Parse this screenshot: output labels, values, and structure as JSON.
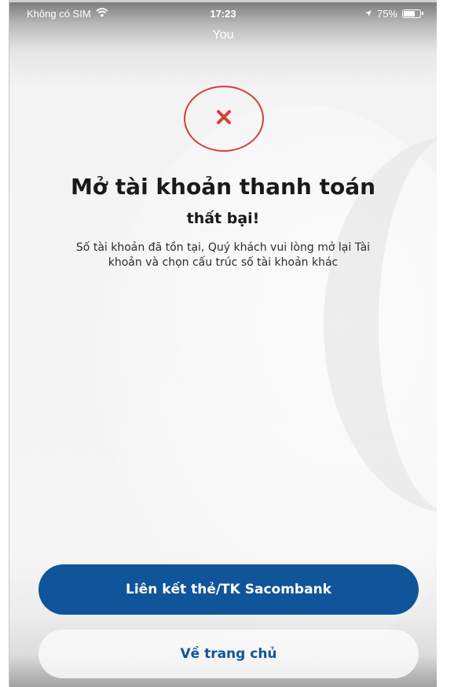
{
  "status_bar": {
    "carrier": "Không có SIM",
    "time": "17:23",
    "battery": "75%",
    "battery_level": 0.75,
    "icons": [
      "wifi-icon",
      "location-arrow-icon",
      "battery-icon"
    ]
  },
  "nav": {
    "title": "You"
  },
  "result": {
    "icon": "close-icon",
    "icon_color": "#d6403a",
    "title_line1": "Mở tài khoản thanh toán",
    "title_line2": "thất bại!",
    "message": "Số tài khoản đã tồn tại, Quý khách vui lòng mở lại Tài khoản và chọn cấu trúc số tài khoản khác"
  },
  "actions": {
    "primary_label": "Liên kết thẻ/TK Sacombank",
    "secondary_label": "Về trang chủ",
    "primary_color": "#10549a"
  }
}
